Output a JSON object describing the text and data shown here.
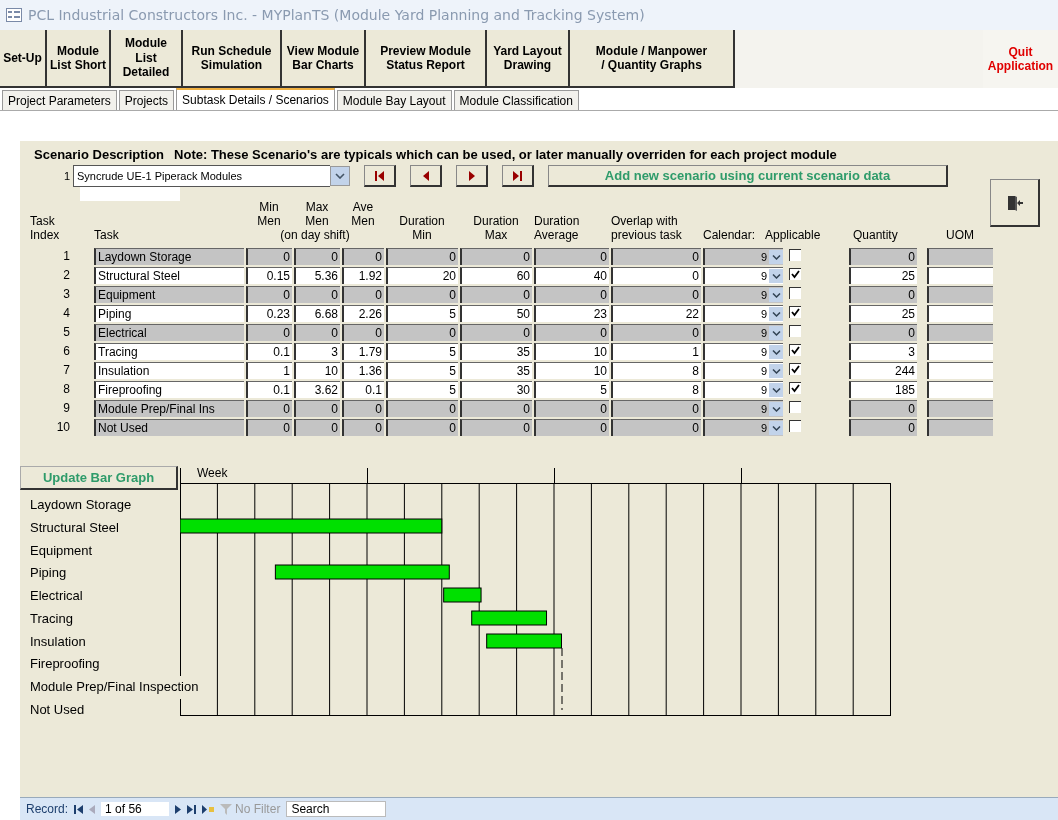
{
  "window": {
    "title": "PCL Industrial Constructors Inc. - MYPlanTS (Module Yard Planning and Tracking System)"
  },
  "toolbar": [
    {
      "label": "Set-Up",
      "kind": "normal"
    },
    {
      "label": "Module\nList  Short",
      "kind": "normal"
    },
    {
      "label": "Module List\nDetailed",
      "kind": "normal"
    },
    {
      "label": "Run Schedule\nSimulation",
      "kind": "normal"
    },
    {
      "label": "View Module\nBar Charts",
      "kind": "normal"
    },
    {
      "label": "Preview Module\nStatus Report",
      "kind": "normal"
    },
    {
      "label": "Yard Layout\nDrawing",
      "kind": "normal"
    },
    {
      "label": "Module / Manpower\n/ Quantity Graphs",
      "kind": "normal"
    },
    {
      "label": "Quit\nApplication",
      "kind": "quit"
    }
  ],
  "tabs": [
    {
      "label": "Project Parameters",
      "selected": false
    },
    {
      "label": "Projects",
      "selected": false
    },
    {
      "label": "Subtask Details / Scenarios",
      "selected": true
    },
    {
      "label": "Module Bay Layout",
      "selected": false
    },
    {
      "label": "Module Classification",
      "selected": false
    }
  ],
  "scenario": {
    "heading": "Scenario Description",
    "note": "Note: These Scenario's are typicals which can be used, or later manually overriden for each project module",
    "index": "1",
    "name": "Syncrude UE-1 Piperack Modules",
    "add_button": "Add new scenario using current scenario data"
  },
  "table": {
    "columns": [
      "Task\nIndex",
      "Task",
      "Min\nMen",
      "Max\nMen",
      "Ave\nMen",
      "Duration\nMin",
      "Duration\nMax",
      "Duration\nAverage",
      "Overlap with\nprevious task",
      "Calendar:",
      "Applicable",
      "Quantity",
      "UOM"
    ],
    "group_label": "(on day shift)",
    "rows": [
      {
        "index": "1",
        "task": "Laydown Storage",
        "min_men": "0",
        "max_men": "0",
        "ave_men": "0",
        "duration_min": "0",
        "duration_max": "0",
        "duration_average": "0",
        "overlap": "0",
        "calendar": "9",
        "applicable": false,
        "quantity": "0"
      },
      {
        "index": "2",
        "task": "Structural Steel",
        "min_men": "0.15",
        "max_men": "5.36",
        "ave_men": "1.92",
        "duration_min": "20",
        "duration_max": "60",
        "duration_average": "40",
        "overlap": "0",
        "calendar": "9",
        "applicable": true,
        "quantity": "25"
      },
      {
        "index": "3",
        "task": "Equipment",
        "min_men": "0",
        "max_men": "0",
        "ave_men": "0",
        "duration_min": "0",
        "duration_max": "0",
        "duration_average": "0",
        "overlap": "0",
        "calendar": "9",
        "applicable": false,
        "quantity": "0"
      },
      {
        "index": "4",
        "task": "Piping",
        "min_men": "0.23",
        "max_men": "6.68",
        "ave_men": "2.26",
        "duration_min": "5",
        "duration_max": "50",
        "duration_average": "23",
        "overlap": "22",
        "calendar": "9",
        "applicable": true,
        "quantity": "25"
      },
      {
        "index": "5",
        "task": "Electrical",
        "min_men": "0",
        "max_men": "0",
        "ave_men": "0",
        "duration_min": "0",
        "duration_max": "0",
        "duration_average": "0",
        "overlap": "0",
        "calendar": "9",
        "applicable": false,
        "quantity": "0"
      },
      {
        "index": "6",
        "task": "Tracing",
        "min_men": "0.1",
        "max_men": "3",
        "ave_men": "1.79",
        "duration_min": "5",
        "duration_max": "35",
        "duration_average": "10",
        "overlap": "1",
        "calendar": "9",
        "applicable": true,
        "quantity": "3"
      },
      {
        "index": "7",
        "task": "Insulation",
        "min_men": "1",
        "max_men": "10",
        "ave_men": "1.36",
        "duration_min": "5",
        "duration_max": "35",
        "duration_average": "10",
        "overlap": "8",
        "calendar": "9",
        "applicable": true,
        "quantity": "244"
      },
      {
        "index": "8",
        "task": "Fireproofing",
        "min_men": "0.1",
        "max_men": "3.62",
        "ave_men": "0.1",
        "duration_min": "5",
        "duration_max": "30",
        "duration_average": "5",
        "overlap": "8",
        "calendar": "9",
        "applicable": true,
        "quantity": "185"
      },
      {
        "index": "9",
        "task": "Module Prep/Final Ins",
        "min_men": "0",
        "max_men": "0",
        "ave_men": "0",
        "duration_min": "0",
        "duration_max": "0",
        "duration_average": "0",
        "overlap": "0",
        "calendar": "9",
        "applicable": false,
        "quantity": "0"
      },
      {
        "index": "10",
        "task": "Not Used",
        "min_men": "0",
        "max_men": "0",
        "ave_men": "0",
        "duration_min": "0",
        "duration_max": "0",
        "duration_average": "0",
        "overlap": "0",
        "calendar": "9",
        "applicable": false,
        "quantity": "0"
      }
    ]
  },
  "gantt": {
    "button": "Update Bar Graph",
    "axis_label": "Week",
    "labels": [
      "Laydown Storage",
      "Structural Steel",
      "Equipment",
      "Piping",
      "Electrical",
      "Tracing",
      "Insulation",
      "Fireproofing",
      "Module Prep/Final Inspection",
      "Not Used"
    ]
  },
  "record_nav": {
    "label": "Record:",
    "position": "1 of 56",
    "filter": "No Filter",
    "search": "Search"
  }
}
